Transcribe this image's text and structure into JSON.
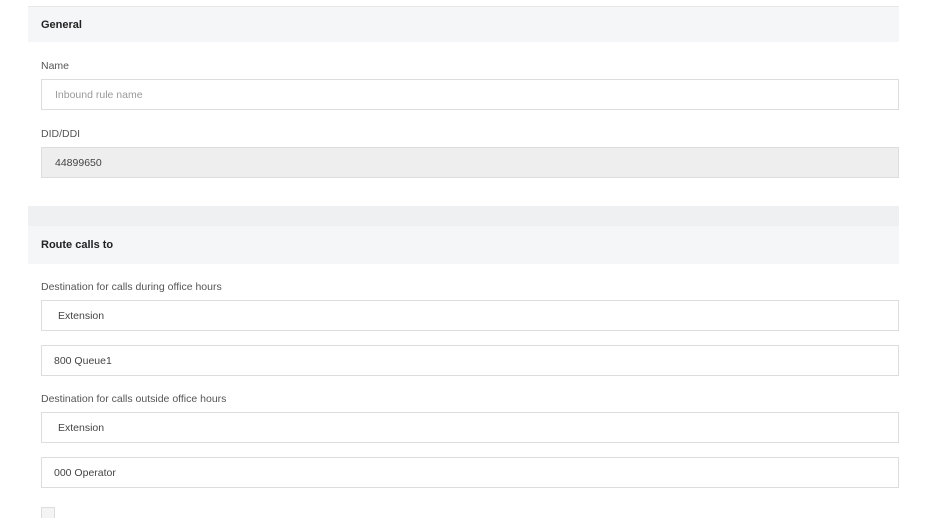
{
  "general": {
    "title": "General",
    "name_label": "Name",
    "name_value": "",
    "name_placeholder": "Inbound rule name",
    "did_label": "DID/DDI",
    "did_value": "44899650"
  },
  "route": {
    "title": "Route calls to",
    "office_hours_label": "Destination for calls during office hours",
    "office_hours_type": "Extension",
    "office_hours_target": "800 Queue1",
    "outside_hours_label": "Destination for calls outside office hours",
    "outside_hours_type": "Extension",
    "outside_hours_target": "000 Operator"
  }
}
